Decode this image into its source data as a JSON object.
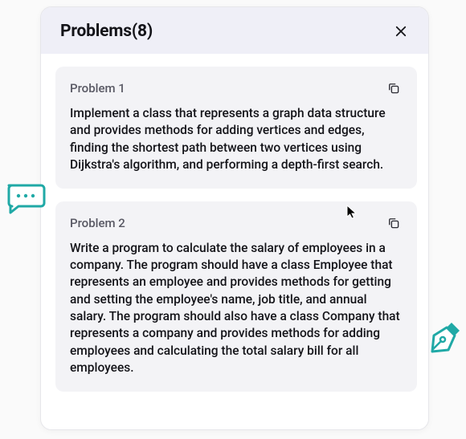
{
  "header": {
    "title": "Problems(8)"
  },
  "problems": [
    {
      "title": "Problem 1",
      "body": "Implement a class that represents a graph data structure and provides methods for adding vertices and edges, finding the shortest path between two vertices using Dijkstra's algorithm, and performing a depth-first search."
    },
    {
      "title": "Problem 2",
      "body": "Write a program to calculate the salary of employees in a company. The program should have a class Employee that represents an employee and provides methods for getting and setting the employee's name, job title, and annual salary. The program should also have a class Company that represents a company and provides methods for adding employees and calculating the total salary bill for all employees."
    }
  ],
  "colors": {
    "teal": "#20a9a6"
  }
}
